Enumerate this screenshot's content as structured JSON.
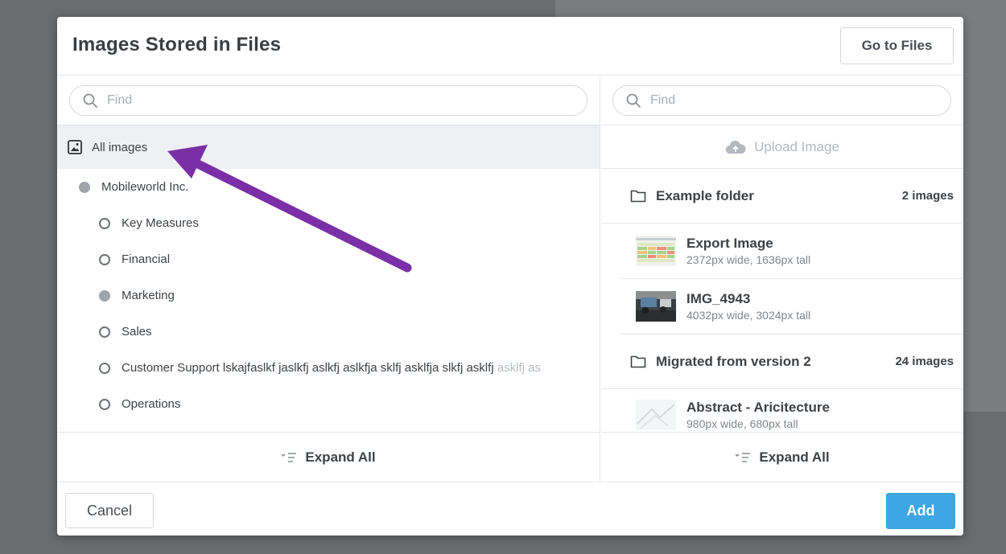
{
  "dialog": {
    "title": "Images Stored in Files",
    "goto_files_label": "Go to Files",
    "cancel_label": "Cancel",
    "add_label": "Add",
    "accent_color": "#3da6e3"
  },
  "left_pane": {
    "search_placeholder": "Find",
    "all_images_label": "All images",
    "tree": [
      {
        "label": "Mobileworld Inc.",
        "state": "filled"
      },
      {
        "label": "Key Measures",
        "state": "empty"
      },
      {
        "label": "Financial",
        "state": "empty"
      },
      {
        "label": "Marketing",
        "state": "filled"
      },
      {
        "label": "Sales",
        "state": "empty"
      },
      {
        "label": "Customer Support lskajfaslkf jaslkfj aslkfj aslkfja sklfj asklfja slkfj asklfj ",
        "label_faded": "asklfj as",
        "state": "empty"
      },
      {
        "label": "Operations",
        "state": "empty"
      }
    ],
    "expand_all_label": "Expand All"
  },
  "right_pane": {
    "search_placeholder": "Find",
    "upload_label": "Upload Image",
    "folders": [
      {
        "name": "Example folder",
        "count": "2 images",
        "images": [
          {
            "title": "Export Image",
            "dims": "2372px wide, 1636px tall"
          },
          {
            "title": "IMG_4943",
            "dims": "4032px wide, 3024px tall"
          }
        ]
      },
      {
        "name": "Migrated from version 2",
        "count": "24 images",
        "images": [
          {
            "title": "Abstract - Aricitecture",
            "dims": "980px wide, 680px tall"
          }
        ]
      }
    ],
    "expand_all_label": "Expand All"
  },
  "annotation": {
    "arrow_color": "#7b2fa6"
  }
}
